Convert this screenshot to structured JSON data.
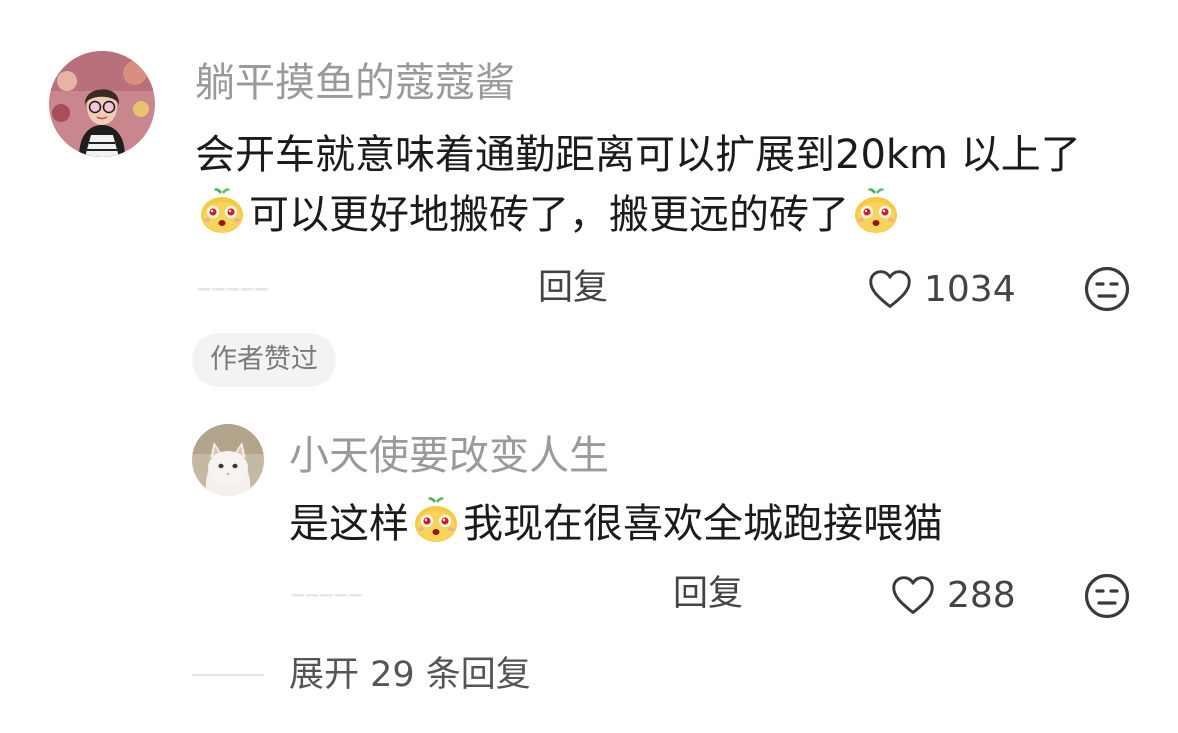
{
  "comment": {
    "username": "躺平摸鱼的蔻蔻酱",
    "line1": "会开车就意味着通勤距离可以扩展到20km 以上了",
    "line2_text": "可以更好地搬砖了，搬更远的砖了",
    "reply_label": "回复",
    "like_count": "1034",
    "author_badge": "作者赞过"
  },
  "reply": {
    "username": "小天使要改变人生",
    "text_before": "是这样",
    "text_after": "我现在很喜欢全城跑接喂猫",
    "reply_label": "回复",
    "like_count": "288"
  },
  "expand_label": "展开 29 条回复",
  "icons": {
    "heart": "heart-outline-icon",
    "dislike": "meh-face-icon",
    "emoji": "yellow-pear-face-emoji"
  },
  "colors": {
    "username": "#9a9a9a",
    "text": "#1b1b1b",
    "badge_bg": "#f3f3f3"
  }
}
